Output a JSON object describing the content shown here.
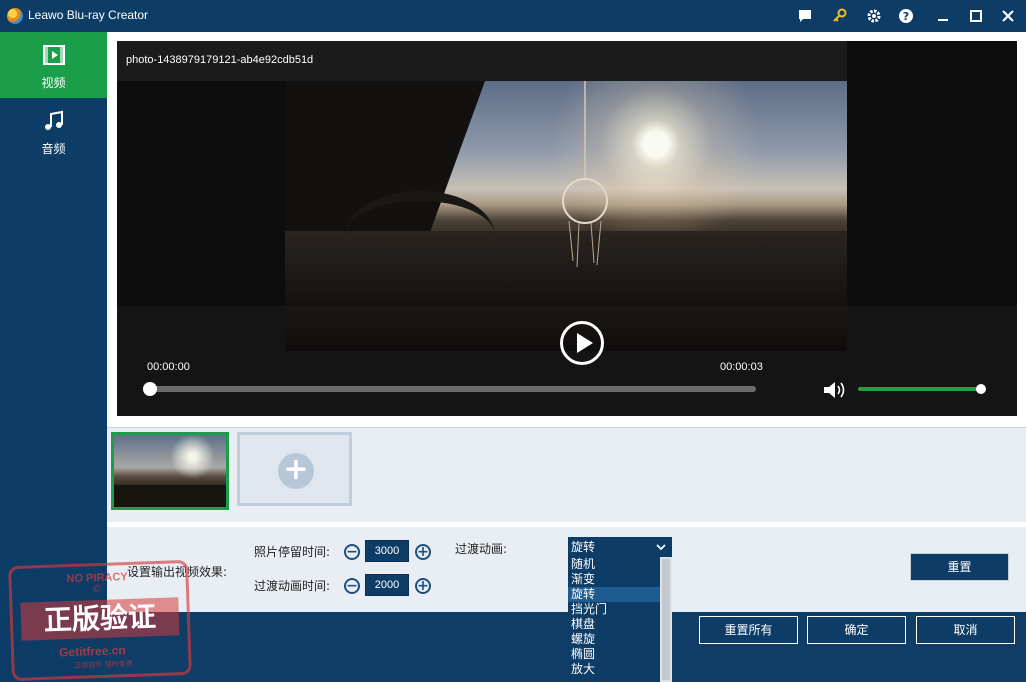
{
  "window": {
    "title": "Leawo Blu-ray Creator"
  },
  "sidebar": {
    "items": [
      {
        "label": "视频",
        "icon": "video-icon",
        "active": true
      },
      {
        "label": "音频",
        "icon": "music-note-icon",
        "active": false
      }
    ]
  },
  "player": {
    "media_title": "photo-1438979179121-ab4e92cdb51d",
    "current_time": "00:00:00",
    "total_time": "00:00:03",
    "progress_fraction": 0.0,
    "volume_fraction": 1.0
  },
  "thumbnail_strip": {
    "add_button_symbol": "+"
  },
  "settings": {
    "output_effect_label": "设置输出视频效果:",
    "photo_duration_label": "照片停留时间:",
    "photo_duration_value": "3000",
    "transition_duration_label": "过渡动画时间:",
    "transition_duration_value": "2000",
    "transition_label": "过渡动画:",
    "transition_selected": "旋转",
    "transition_options": [
      "随机",
      "渐变",
      "旋转",
      "挡光门",
      "棋盘",
      "螺旋",
      "椭圆",
      "放大"
    ],
    "minus_symbol": "−",
    "plus_symbol": "+"
  },
  "buttons": {
    "reset": "重置",
    "reset_all": "重置所有",
    "confirm": "确定",
    "cancel": "取消"
  },
  "watermark": {
    "top": "NO PIRACY",
    "copyright": "©",
    "main": "正版验证",
    "site": "Getitfree.cn",
    "sub": "正版软件 限时免费"
  },
  "colors": {
    "titlebar": "#0d3c67",
    "accent_green": "#1a9e4a",
    "content_bg": "#e8eef4"
  }
}
